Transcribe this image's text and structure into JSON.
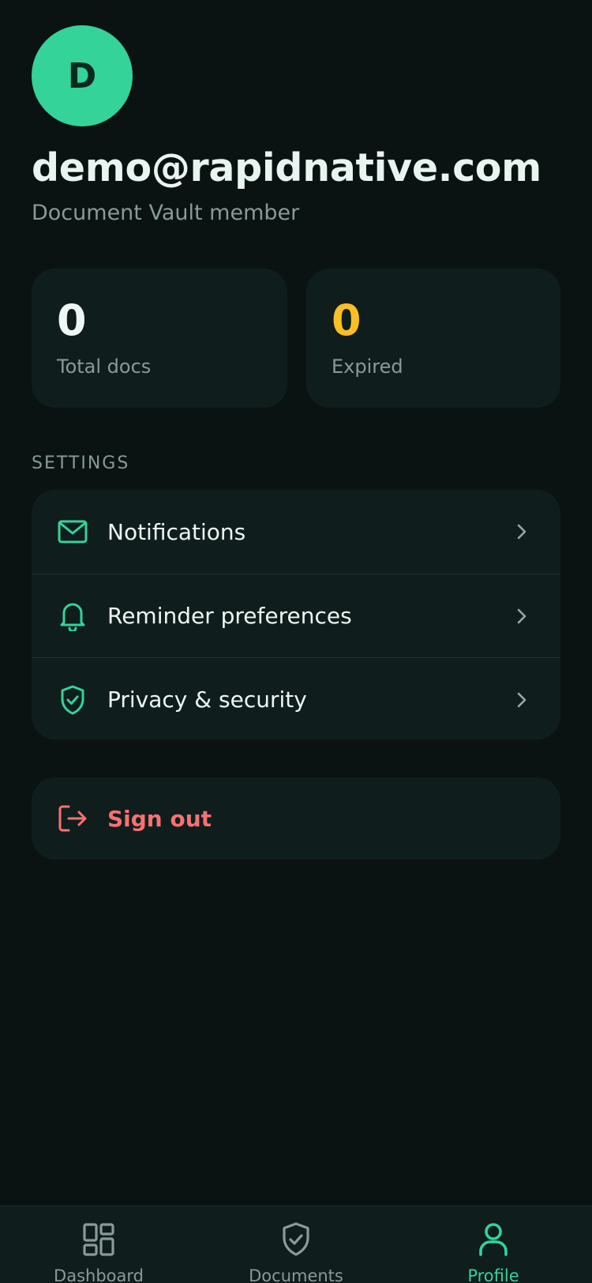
{
  "profile": {
    "avatar_initial": "D",
    "email": "demo@rapidnative.com",
    "subtitle": "Document Vault member"
  },
  "stats": [
    {
      "value": "0",
      "label": "Total docs"
    },
    {
      "value": "0",
      "label": "Expired"
    }
  ],
  "settings": {
    "section_title": "SETTINGS",
    "items": [
      {
        "label": "Notifications",
        "icon": "mail-icon"
      },
      {
        "label": "Reminder preferences",
        "icon": "bell-icon"
      },
      {
        "label": "Privacy & security",
        "icon": "shield-check-icon"
      }
    ]
  },
  "signout": {
    "label": "Sign out",
    "icon": "sign-out-icon"
  },
  "tabbar": {
    "tabs": [
      {
        "label": "Dashboard",
        "icon": "grid-icon"
      },
      {
        "label": "Documents",
        "icon": "shield-check-icon"
      },
      {
        "label": "Profile",
        "icon": "user-icon",
        "active": true
      }
    ]
  },
  "colors": {
    "accent": "#34d399",
    "warning": "#fbbf24",
    "danger": "#f87171",
    "background": "#0a1312",
    "card": "#0f1e1d"
  }
}
